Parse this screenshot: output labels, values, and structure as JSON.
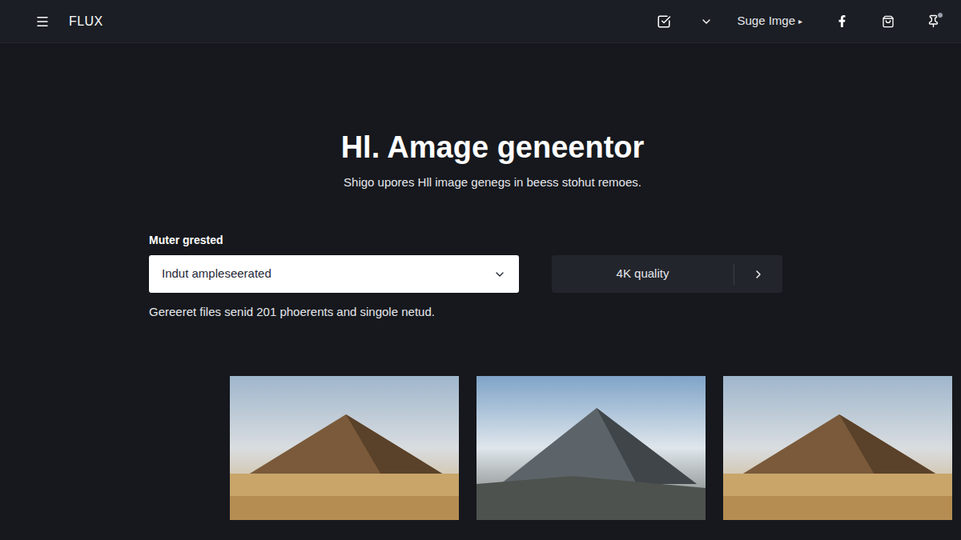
{
  "nav": {
    "logo": "FLUX",
    "menu_link": {
      "label": "Suge Imge",
      "arrow": "▸"
    }
  },
  "hero": {
    "title": "Hl. Amage geneentor",
    "subtitle": "Shigo upores Hll image genegs in beess stohut remoes."
  },
  "form": {
    "label": "Muter grested",
    "select_value": "Indut ampleseerated",
    "quality_button": "4K quality",
    "helper": "Gereeret files senid 201 phoerents and singole netud."
  },
  "gallery": [
    {
      "kind": "warm"
    },
    {
      "kind": "rocky"
    },
    {
      "kind": "warm"
    }
  ]
}
